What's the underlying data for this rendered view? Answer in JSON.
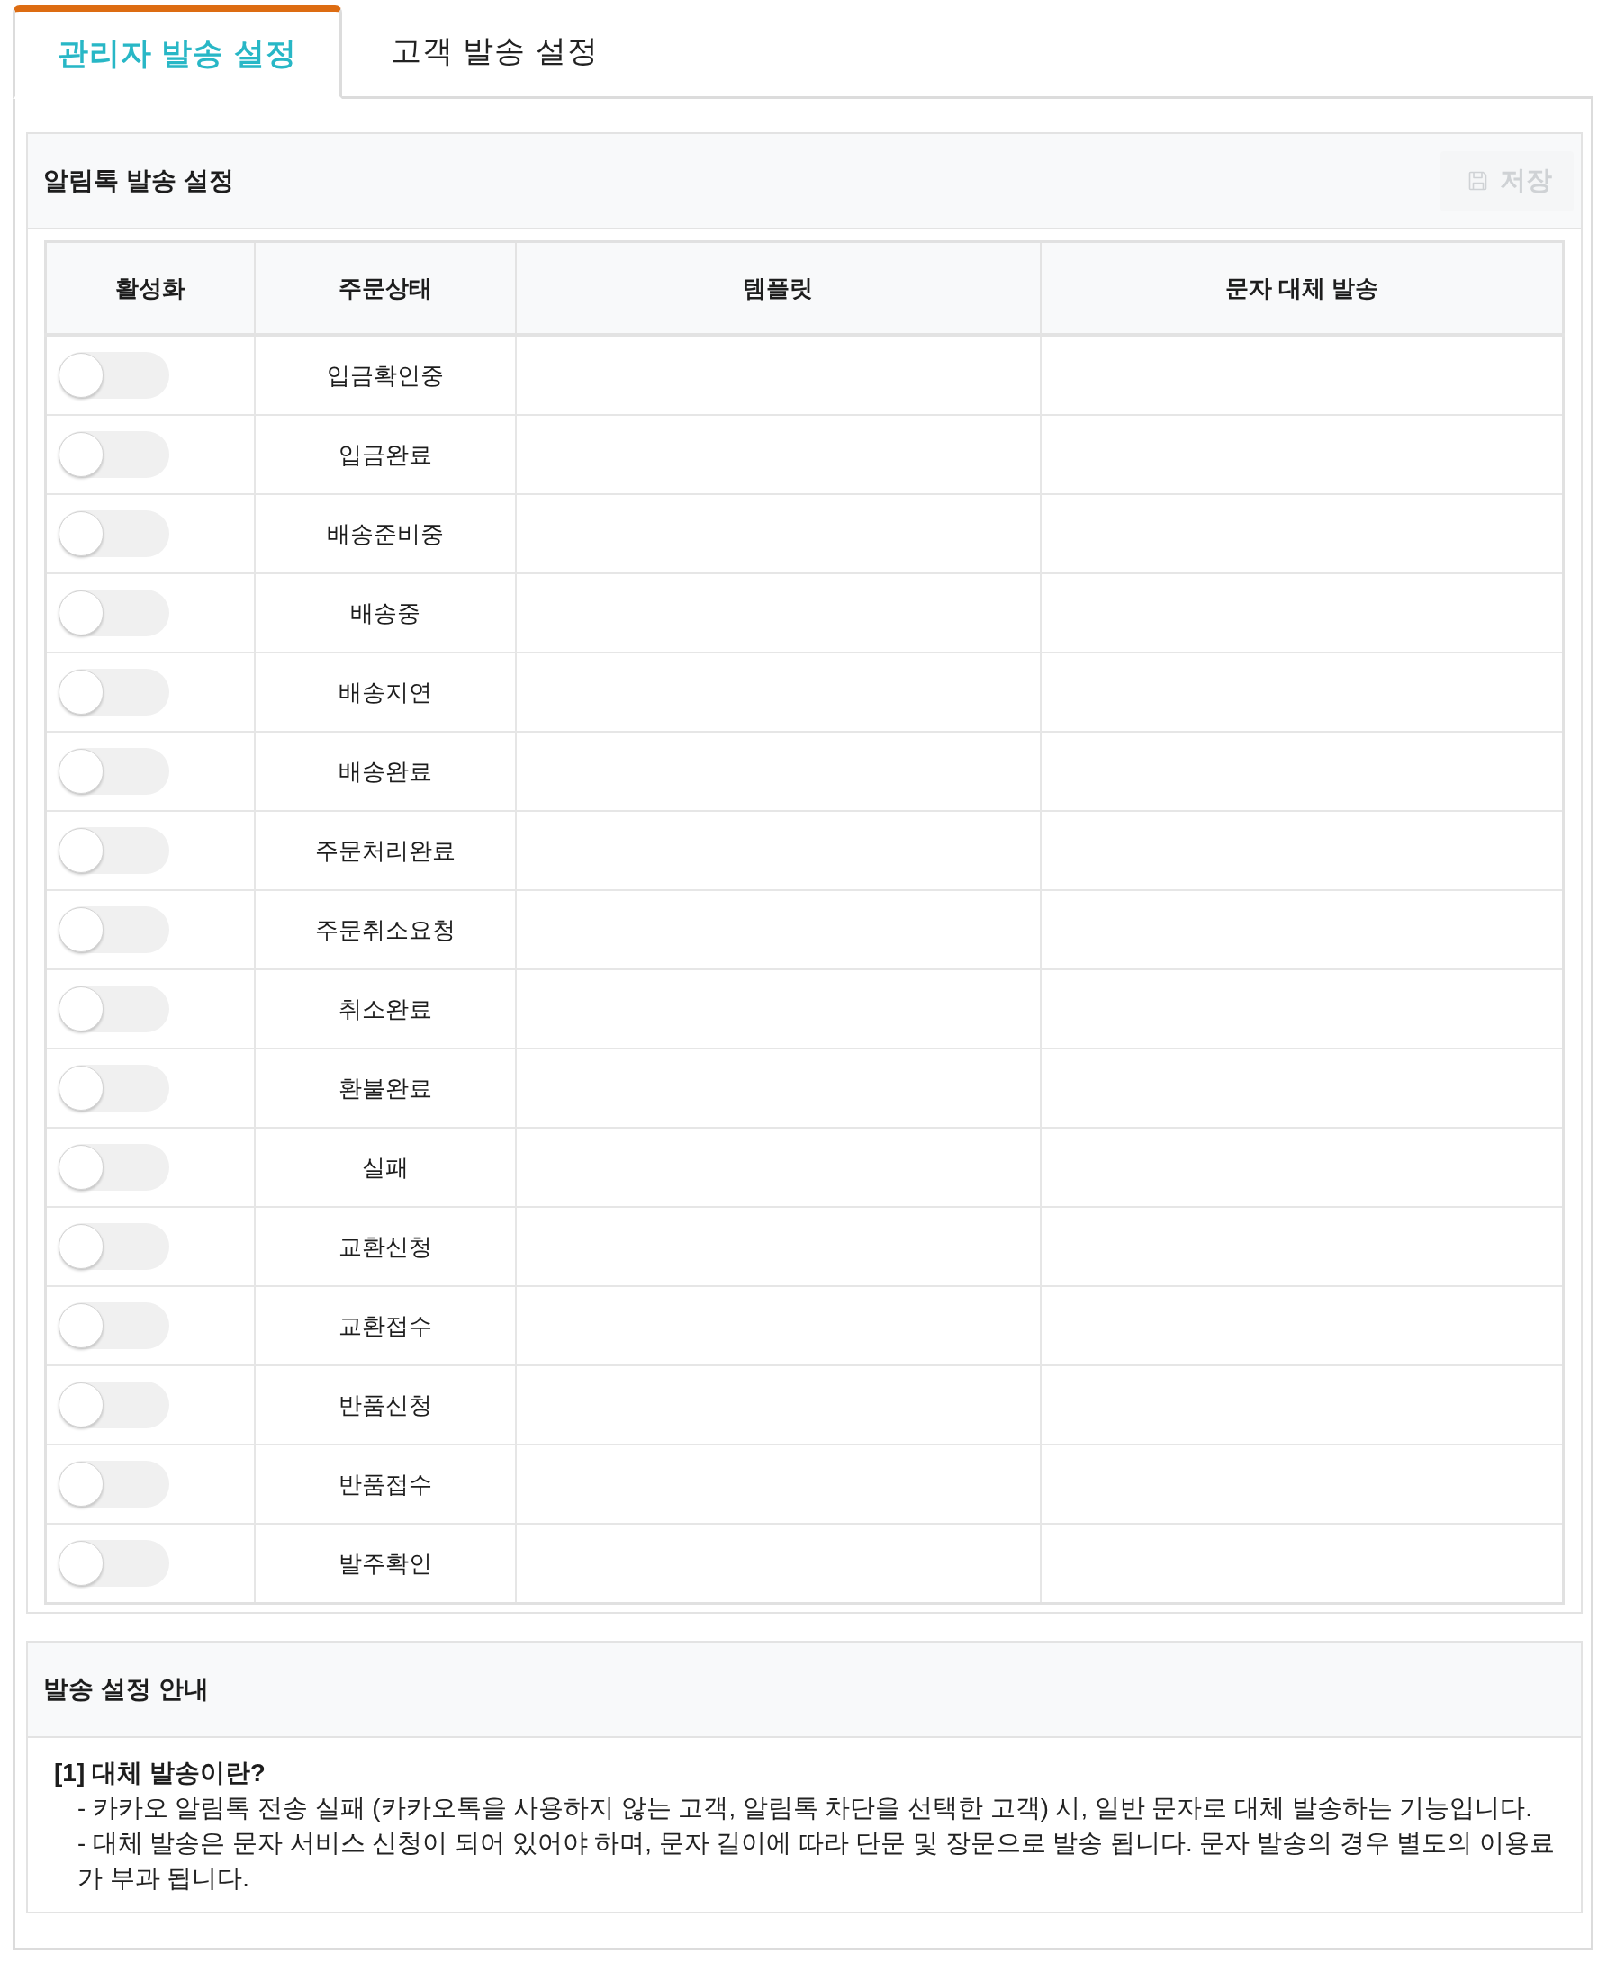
{
  "tabs": [
    {
      "label": "관리자 발송 설정",
      "selected": true
    },
    {
      "label": "고객 발송 설정",
      "selected": false
    }
  ],
  "alimtalk_panel": {
    "title": "알림톡 발송 설정",
    "save_button": {
      "label": "저장",
      "disabled": true
    },
    "table": {
      "columns": [
        "활성화",
        "주문상태",
        "템플릿",
        "문자 대체 발송"
      ],
      "rows": [
        {
          "on": false,
          "status": "입금확인중"
        },
        {
          "on": false,
          "status": "입금완료"
        },
        {
          "on": false,
          "status": "배송준비중"
        },
        {
          "on": false,
          "status": "배송중"
        },
        {
          "on": false,
          "status": "배송지연"
        },
        {
          "on": false,
          "status": "배송완료"
        },
        {
          "on": false,
          "status": "주문처리완료"
        },
        {
          "on": false,
          "status": "주문취소요청"
        },
        {
          "on": false,
          "status": "취소완료"
        },
        {
          "on": false,
          "status": "환불완료"
        },
        {
          "on": false,
          "status": "실패"
        },
        {
          "on": false,
          "status": "교환신청"
        },
        {
          "on": false,
          "status": "교환접수"
        },
        {
          "on": false,
          "status": "반품신청"
        },
        {
          "on": false,
          "status": "반품접수"
        },
        {
          "on": false,
          "status": "발주확인"
        }
      ]
    }
  },
  "guide_panel": {
    "title": "발송 설정 안내",
    "heading": "[1] 대체 발송이란?",
    "lines": [
      "- 카카오 알림톡 전송 실패 (카카오톡을 사용하지 않는 고객, 알림톡 차단을 선택한 고객) 시, 일반 문자로 대체 발송하는 기능입니다.",
      "- 대체 발송은 문자 서비스 신청이 되어 있어야 하며, 문자 길이에 따라 단문 및 장문으로 발송 됩니다. 문자 발송의 경우 별도의 이용료가 부과 됩니다."
    ]
  }
}
